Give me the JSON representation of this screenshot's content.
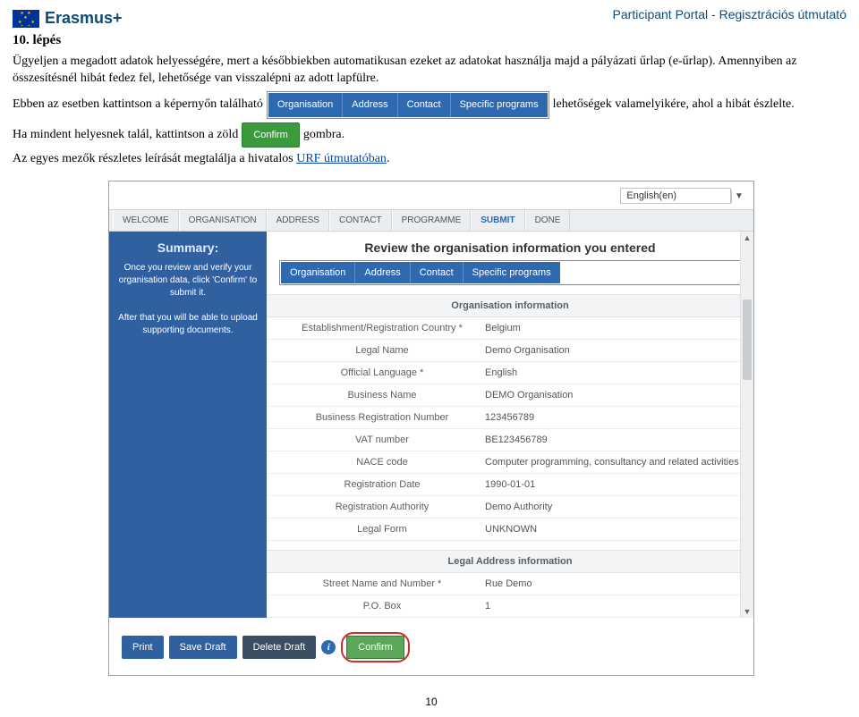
{
  "header": {
    "right_text": "Participant Portal - Regisztrációs útmutató",
    "erasmus_label": "Erasmus+"
  },
  "step": "10. lépés",
  "para1": "Ügyeljen a megadott adatok helyességére, mert a későbbiekben automatikusan ezeket az adatokat használja majd a pályázati űrlap (e-űrlap). Amennyiben az összesítésnél hibát fedez fel, lehetősége van visszalépni az adott lapfülre.",
  "inline1_pre": "Ebben az esetben kattintson a képernyőn található",
  "inline1_post": "lehetőségek valamelyikére, ahol a hibát észlelte.",
  "blue_tabs": {
    "t1": "Organisation",
    "t2": "Address",
    "t3": "Contact",
    "t4": "Specific programs"
  },
  "inline2_pre": "Ha mindent helyesnek talál, kattintson a zöld",
  "inline2_post": "gombra.",
  "confirm_label": "Confirm",
  "para2_pre": "Az egyes mezők részletes leírását megtalálja a hivatalos ",
  "para2_link": "URF útmutatóban",
  "para2_post": ".",
  "lang_value": "English(en)",
  "wizard": {
    "s1": "WELCOME",
    "s2": "ORGANISATION",
    "s3": "ADDRESS",
    "s4": "CONTACT",
    "s5": "PROGRAMME",
    "s6": "SUBMIT",
    "s7": "DONE"
  },
  "sidebar": {
    "title": "Summary:",
    "p1": "Once you review and verify your organisation data, click 'Confirm' to submit it.",
    "p2": "After that you will be able to upload supporting documents."
  },
  "review_title": "Review the organisation information you entered",
  "section1": "Organisation information",
  "section2": "Legal Address information",
  "fields": {
    "establishment_k": "Establishment/Registration Country *",
    "establishment_v": "Belgium",
    "legalname_k": "Legal Name",
    "legalname_v": "Demo Organisation",
    "lang_k": "Official Language *",
    "lang_v": "English",
    "bizname_k": "Business Name",
    "bizname_v": "DEMO Organisation",
    "regnum_k": "Business Registration Number",
    "regnum_v": "123456789",
    "vat_k": "VAT number",
    "vat_v": "BE123456789",
    "nace_k": "NACE code",
    "nace_v": "Computer programming, consultancy and related activities",
    "regdate_k": "Registration Date",
    "regdate_v": "1990-01-01",
    "regauth_k": "Registration Authority",
    "regauth_v": "Demo Authority",
    "legalform_k": "Legal Form",
    "legalform_v": "UNKNOWN",
    "street_k": "Street Name and Number *",
    "street_v": "Rue Demo",
    "pobox_k": "P.O. Box",
    "pobox_v": "1"
  },
  "actions": {
    "print": "Print",
    "save": "Save Draft",
    "delete": "Delete Draft",
    "confirm": "Confirm",
    "info": "i"
  },
  "page_number": "10"
}
